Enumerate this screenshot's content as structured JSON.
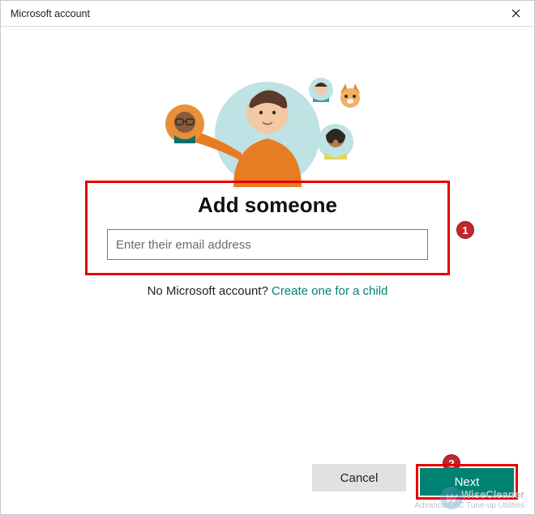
{
  "titlebar": {
    "title": "Microsoft account"
  },
  "hero": {
    "heading": "Add someone",
    "email_placeholder": "Enter their email address",
    "email_value": ""
  },
  "subtext": {
    "prefix": "No Microsoft account? ",
    "link": "Create one for a child"
  },
  "buttons": {
    "cancel": "Cancel",
    "next": "Next"
  },
  "callouts": {
    "one": "1",
    "two": "2"
  },
  "watermark": {
    "brand": "WiseCleaner",
    "tagline": "Advanced PC Tune-up Utilities",
    "logo_letter": "W"
  },
  "colors": {
    "accent": "#008272",
    "annotation_red": "#e60000",
    "callout_fill": "#c1272d"
  }
}
